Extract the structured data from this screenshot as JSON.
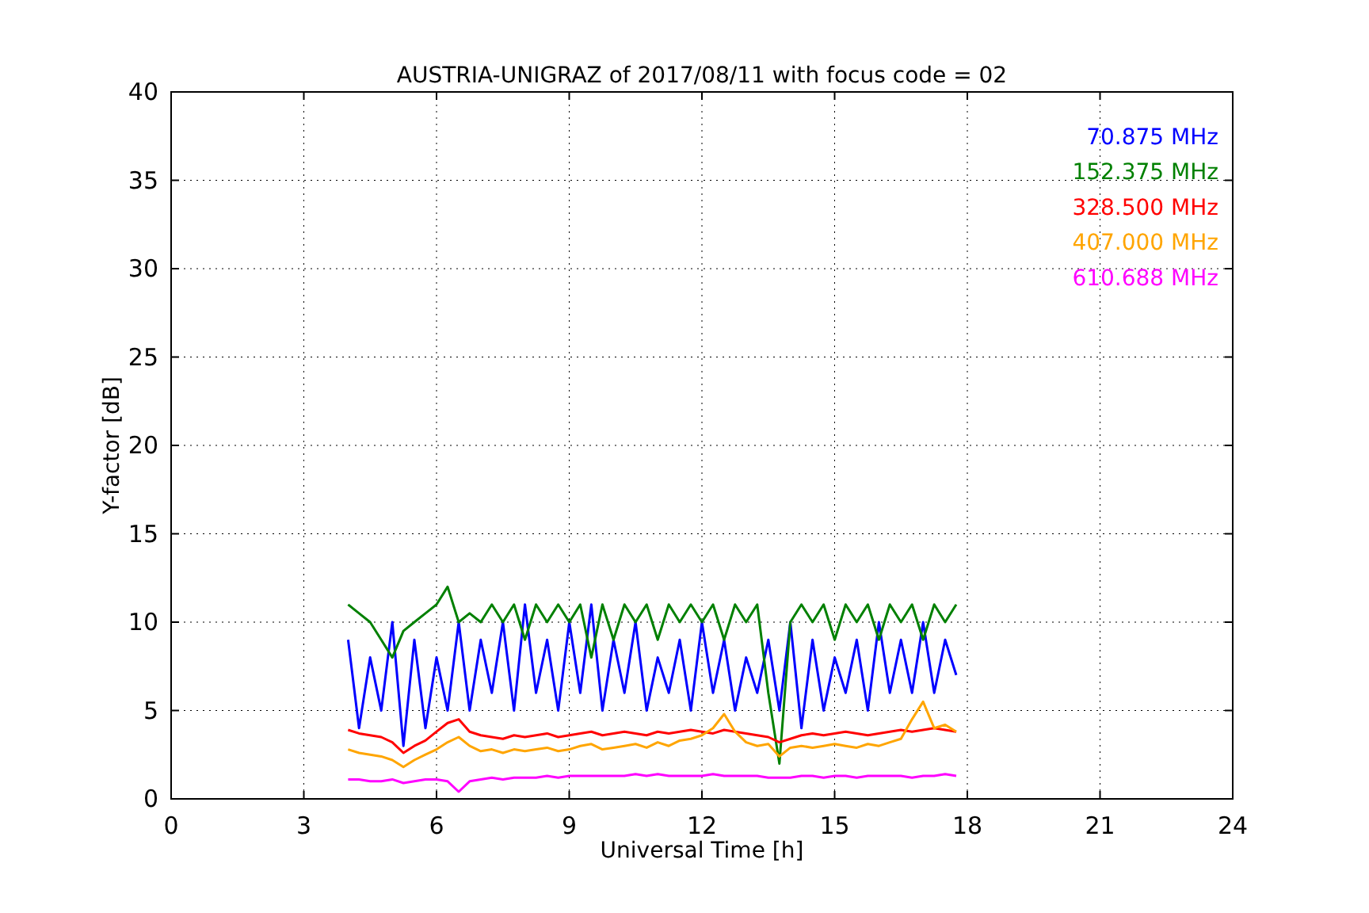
{
  "figure": {
    "chart_data": {
      "type": "line",
      "title": "AUSTRIA-UNIGRAZ of 2017/08/11 with focus code = 02",
      "xlabel": "Universal Time [h]",
      "ylabel": "Y-factor [dB]",
      "x": [
        4,
        4.25,
        4.5,
        4.75,
        5,
        5.25,
        5.5,
        5.75,
        6,
        6.25,
        6.5,
        6.75,
        7,
        7.25,
        7.5,
        7.75,
        8,
        8.25,
        8.5,
        8.75,
        9,
        9.25,
        9.5,
        9.75,
        10,
        10.25,
        10.5,
        10.75,
        11,
        11.25,
        11.5,
        11.75,
        12,
        12.25,
        12.5,
        12.75,
        13,
        13.25,
        13.5,
        13.75,
        14,
        14.25,
        14.5,
        14.75,
        15,
        15.25,
        15.5,
        15.75,
        16,
        16.25,
        16.5,
        16.75,
        17,
        17.25,
        17.5,
        17.75
      ],
      "series": [
        {
          "name": "70.875 MHz",
          "color": "#0000ff",
          "values": [
            9,
            4,
            8,
            5,
            10,
            3,
            9,
            4,
            8,
            5,
            10,
            5,
            9,
            6,
            10,
            5,
            11,
            6,
            9,
            5,
            10,
            6,
            11,
            5,
            9,
            6,
            10,
            5,
            8,
            6,
            9,
            5,
            10,
            6,
            9,
            5,
            8,
            6,
            9,
            5,
            10,
            4,
            9,
            5,
            8,
            6,
            9,
            5,
            10,
            6,
            9,
            6,
            10,
            6,
            9,
            7
          ]
        },
        {
          "name": "152.375 MHz",
          "color": "#008000",
          "values": [
            11,
            10.5,
            10,
            9,
            8,
            9.5,
            10,
            10.5,
            11,
            12,
            10,
            10.5,
            10,
            11,
            10,
            11,
            9,
            11,
            10,
            11,
            10,
            11,
            8,
            11,
            9,
            11,
            10,
            11,
            9,
            11,
            10,
            11,
            10,
            11,
            9,
            11,
            10,
            11,
            6,
            2,
            10,
            11,
            10,
            11,
            9,
            11,
            10,
            11,
            9,
            11,
            10,
            11,
            9,
            11,
            10,
            11
          ]
        },
        {
          "name": "328.500 MHz",
          "color": "#ff0000",
          "values": [
            3.9,
            3.7,
            3.6,
            3.5,
            3.2,
            2.6,
            3.0,
            3.3,
            3.8,
            4.3,
            4.5,
            3.8,
            3.6,
            3.5,
            3.4,
            3.6,
            3.5,
            3.6,
            3.7,
            3.5,
            3.6,
            3.7,
            3.8,
            3.6,
            3.7,
            3.8,
            3.7,
            3.6,
            3.8,
            3.7,
            3.8,
            3.9,
            3.8,
            3.7,
            3.9,
            3.8,
            3.7,
            3.6,
            3.5,
            3.2,
            3.4,
            3.6,
            3.7,
            3.6,
            3.7,
            3.8,
            3.7,
            3.6,
            3.7,
            3.8,
            3.9,
            3.8,
            3.9,
            4.0,
            3.9,
            3.8
          ]
        },
        {
          "name": "407.000 MHz",
          "color": "#ffa500",
          "values": [
            2.8,
            2.6,
            2.5,
            2.4,
            2.2,
            1.8,
            2.2,
            2.5,
            2.8,
            3.2,
            3.5,
            3.0,
            2.7,
            2.8,
            2.6,
            2.8,
            2.7,
            2.8,
            2.9,
            2.7,
            2.8,
            3.0,
            3.1,
            2.8,
            2.9,
            3.0,
            3.1,
            2.9,
            3.2,
            3.0,
            3.3,
            3.4,
            3.6,
            4.0,
            4.8,
            3.8,
            3.2,
            3.0,
            3.1,
            2.4,
            2.9,
            3.0,
            2.9,
            3.0,
            3.1,
            3.0,
            2.9,
            3.1,
            3.0,
            3.2,
            3.4,
            4.5,
            5.5,
            4.0,
            4.2,
            3.8
          ]
        },
        {
          "name": "610.688 MHz",
          "color": "#ff00ff",
          "values": [
            1.1,
            1.1,
            1.0,
            1.0,
            1.1,
            0.9,
            1.0,
            1.1,
            1.1,
            1.0,
            0.4,
            1.0,
            1.1,
            1.2,
            1.1,
            1.2,
            1.2,
            1.2,
            1.3,
            1.2,
            1.3,
            1.3,
            1.3,
            1.3,
            1.3,
            1.3,
            1.4,
            1.3,
            1.4,
            1.3,
            1.3,
            1.3,
            1.3,
            1.4,
            1.3,
            1.3,
            1.3,
            1.3,
            1.2,
            1.2,
            1.2,
            1.3,
            1.3,
            1.2,
            1.3,
            1.3,
            1.2,
            1.3,
            1.3,
            1.3,
            1.3,
            1.2,
            1.3,
            1.3,
            1.4,
            1.3
          ]
        }
      ],
      "xlim": [
        0,
        24
      ],
      "ylim": [
        0,
        40
      ],
      "xticks": [
        0,
        3,
        6,
        9,
        12,
        15,
        18,
        21,
        24
      ],
      "yticks": [
        0,
        5,
        10,
        15,
        20,
        25,
        30,
        35,
        40
      ],
      "grid": true
    }
  }
}
